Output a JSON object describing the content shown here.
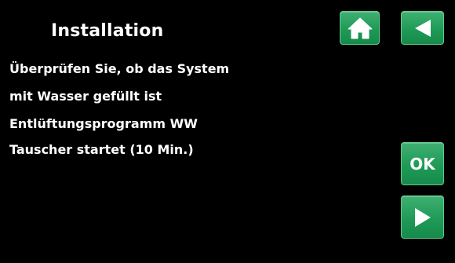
{
  "screen": {
    "title": "Installation",
    "message_lines": [
      "Überprüfen Sie, ob das System",
      "mit Wasser gefüllt ist",
      "Entlüftungsprogramm WW",
      "Tauscher startet (10 Min.)"
    ]
  },
  "buttons": {
    "home_icon": "home-icon",
    "back_icon": "back-arrow-icon",
    "ok_label": "OK",
    "next_icon": "forward-arrow-icon"
  },
  "colors": {
    "background": "#000000",
    "text": "#ffffff",
    "button_green": "#1f9a57",
    "button_border": "#5fca8c"
  }
}
